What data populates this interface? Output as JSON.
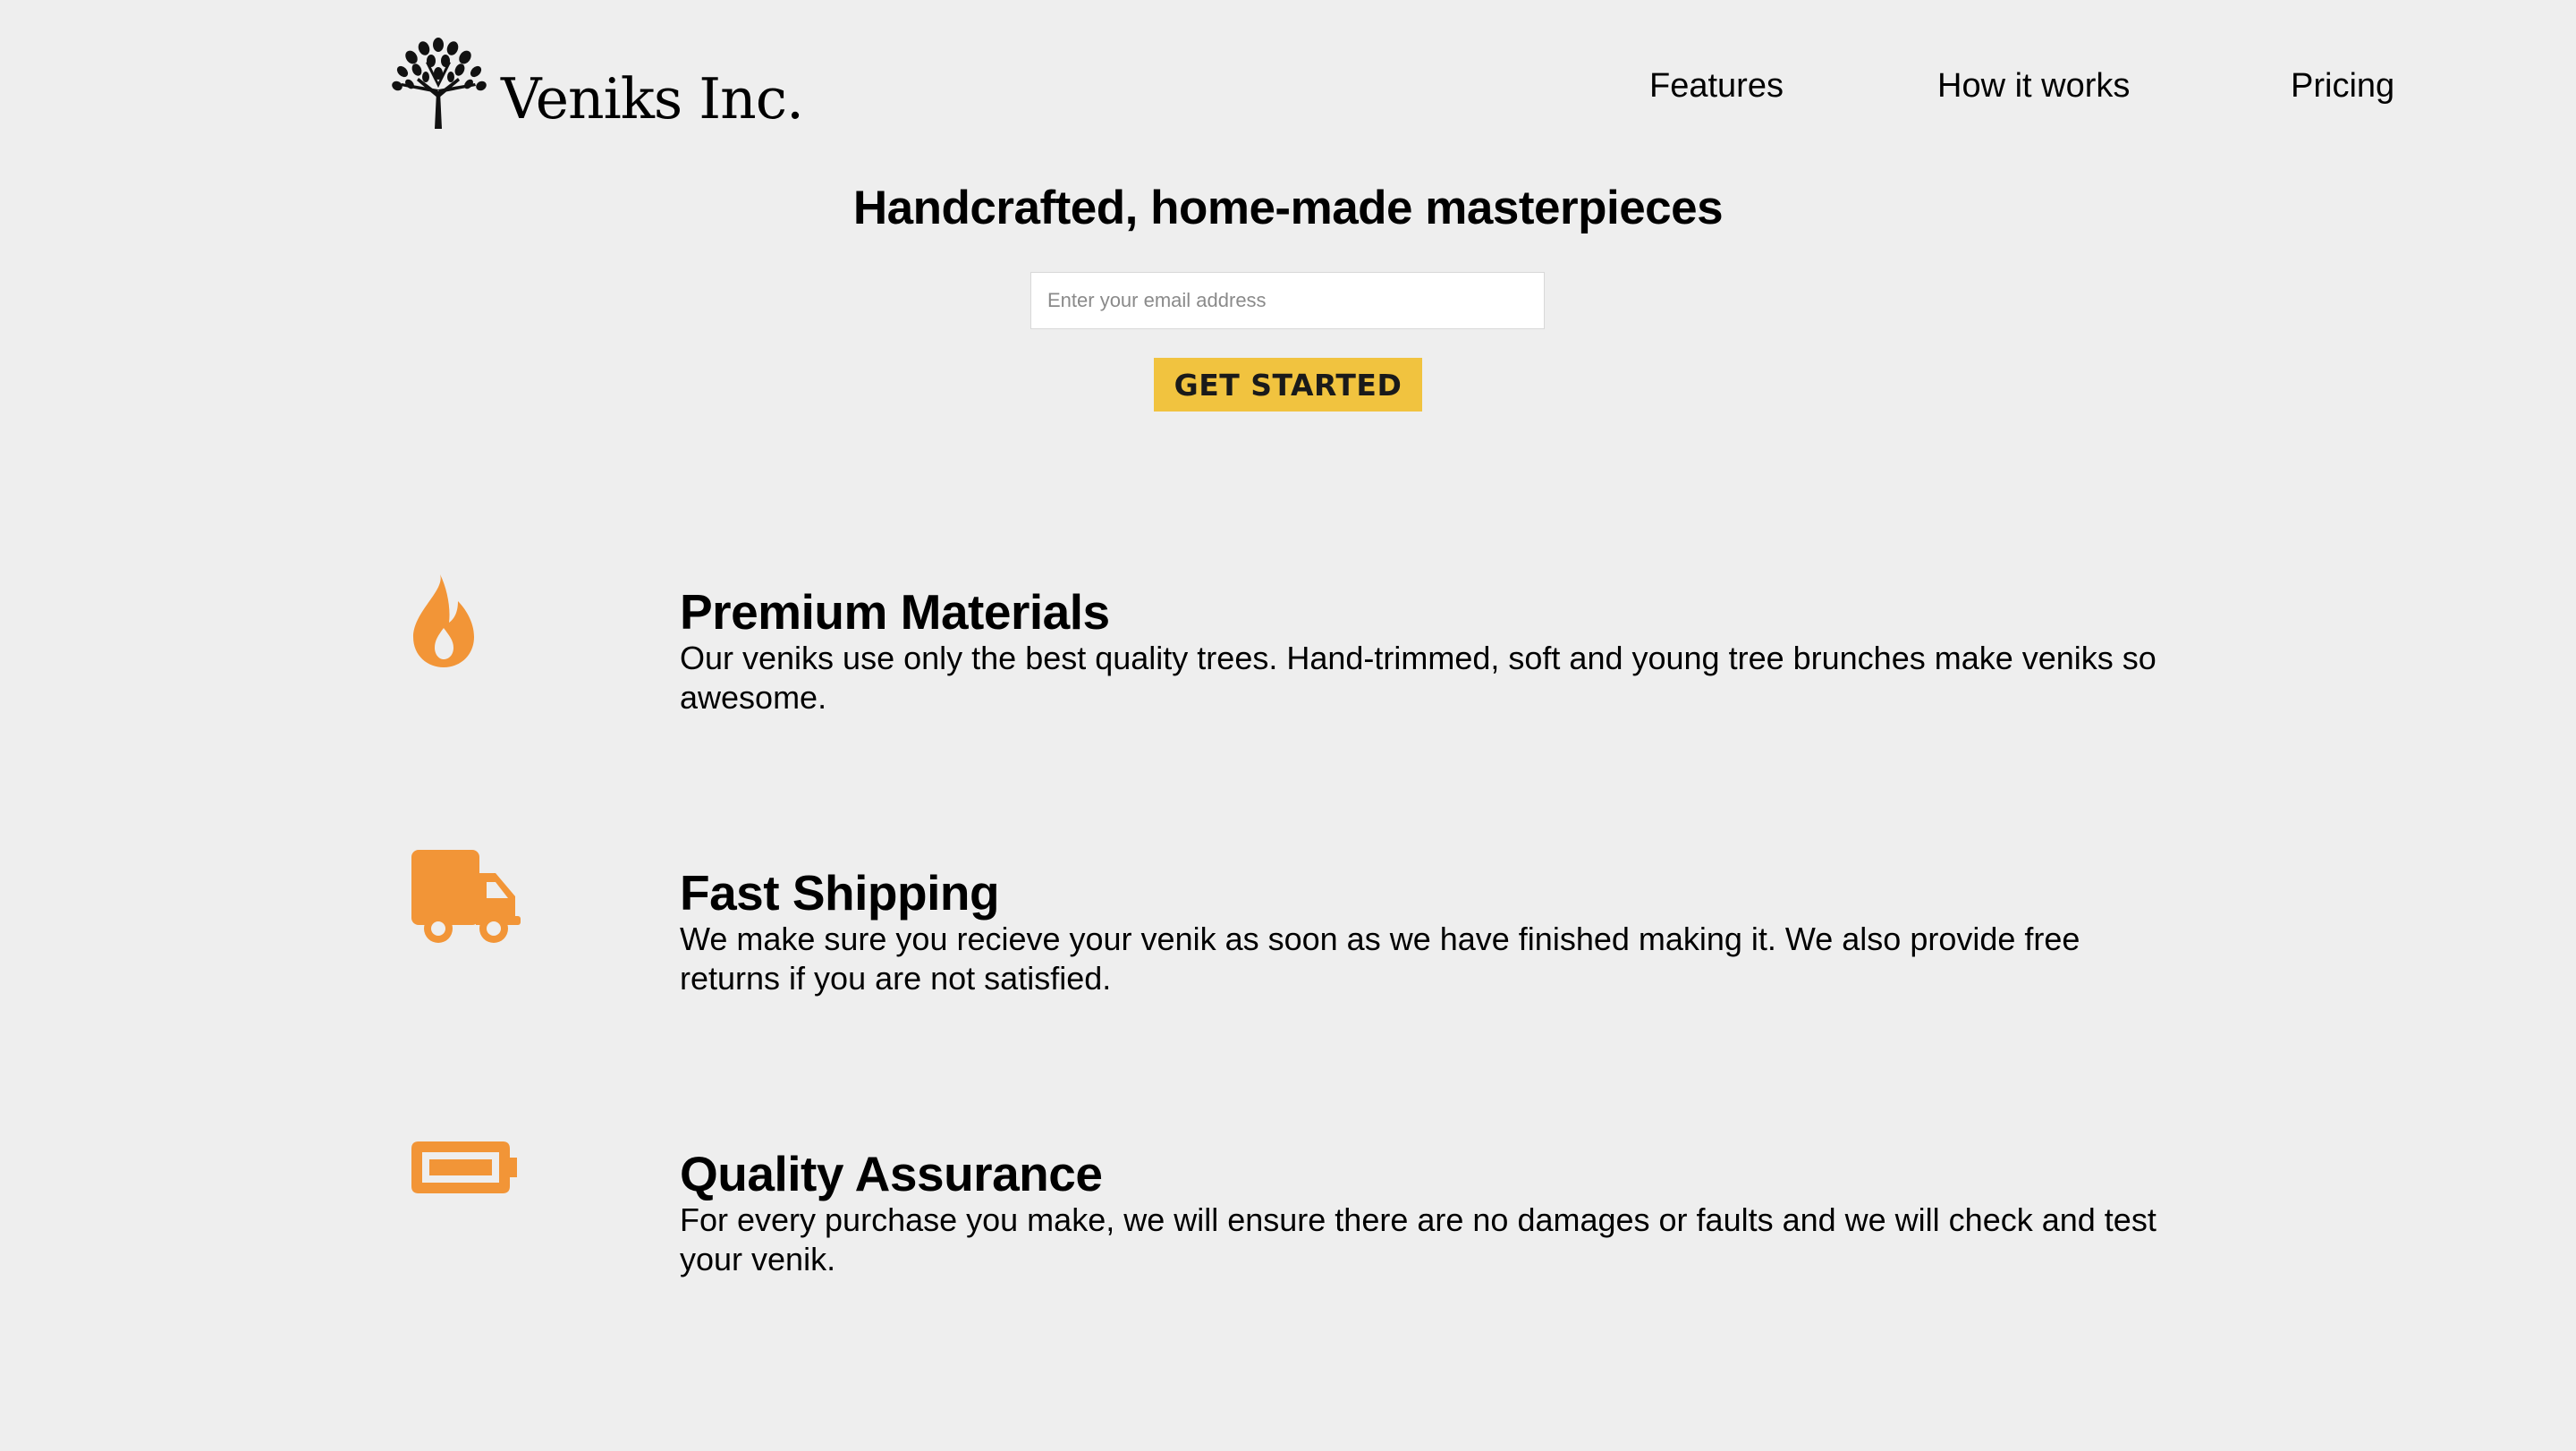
{
  "header": {
    "brand_name": "Veniks Inc.",
    "logo_icon": "tree-icon",
    "nav": [
      {
        "label": "Features"
      },
      {
        "label": "How it works"
      },
      {
        "label": "Pricing"
      }
    ]
  },
  "hero": {
    "title": "Handcrafted, home-made masterpieces",
    "email_placeholder": "Enter your email address",
    "email_value": "",
    "cta_label": "GET STARTED"
  },
  "features": [
    {
      "icon": "fire-icon",
      "title": "Premium Materials",
      "text": "Our veniks use only the best quality trees. Hand-trimmed, soft and young tree brunches make veniks so awesome."
    },
    {
      "icon": "truck-icon",
      "title": "Fast Shipping",
      "text": "We make sure you recieve your venik as soon as we have finished making it. We also provide free returns if you are not satisfied."
    },
    {
      "icon": "battery-icon",
      "title": "Quality Assurance",
      "text": "For every purchase you make, we will ensure there are no damages or faults and we will check and test your venik."
    }
  ],
  "colors": {
    "background": "#eeeeee",
    "accent_icon": "#f29537",
    "cta_background": "#f1c33f",
    "text": "#000000"
  }
}
